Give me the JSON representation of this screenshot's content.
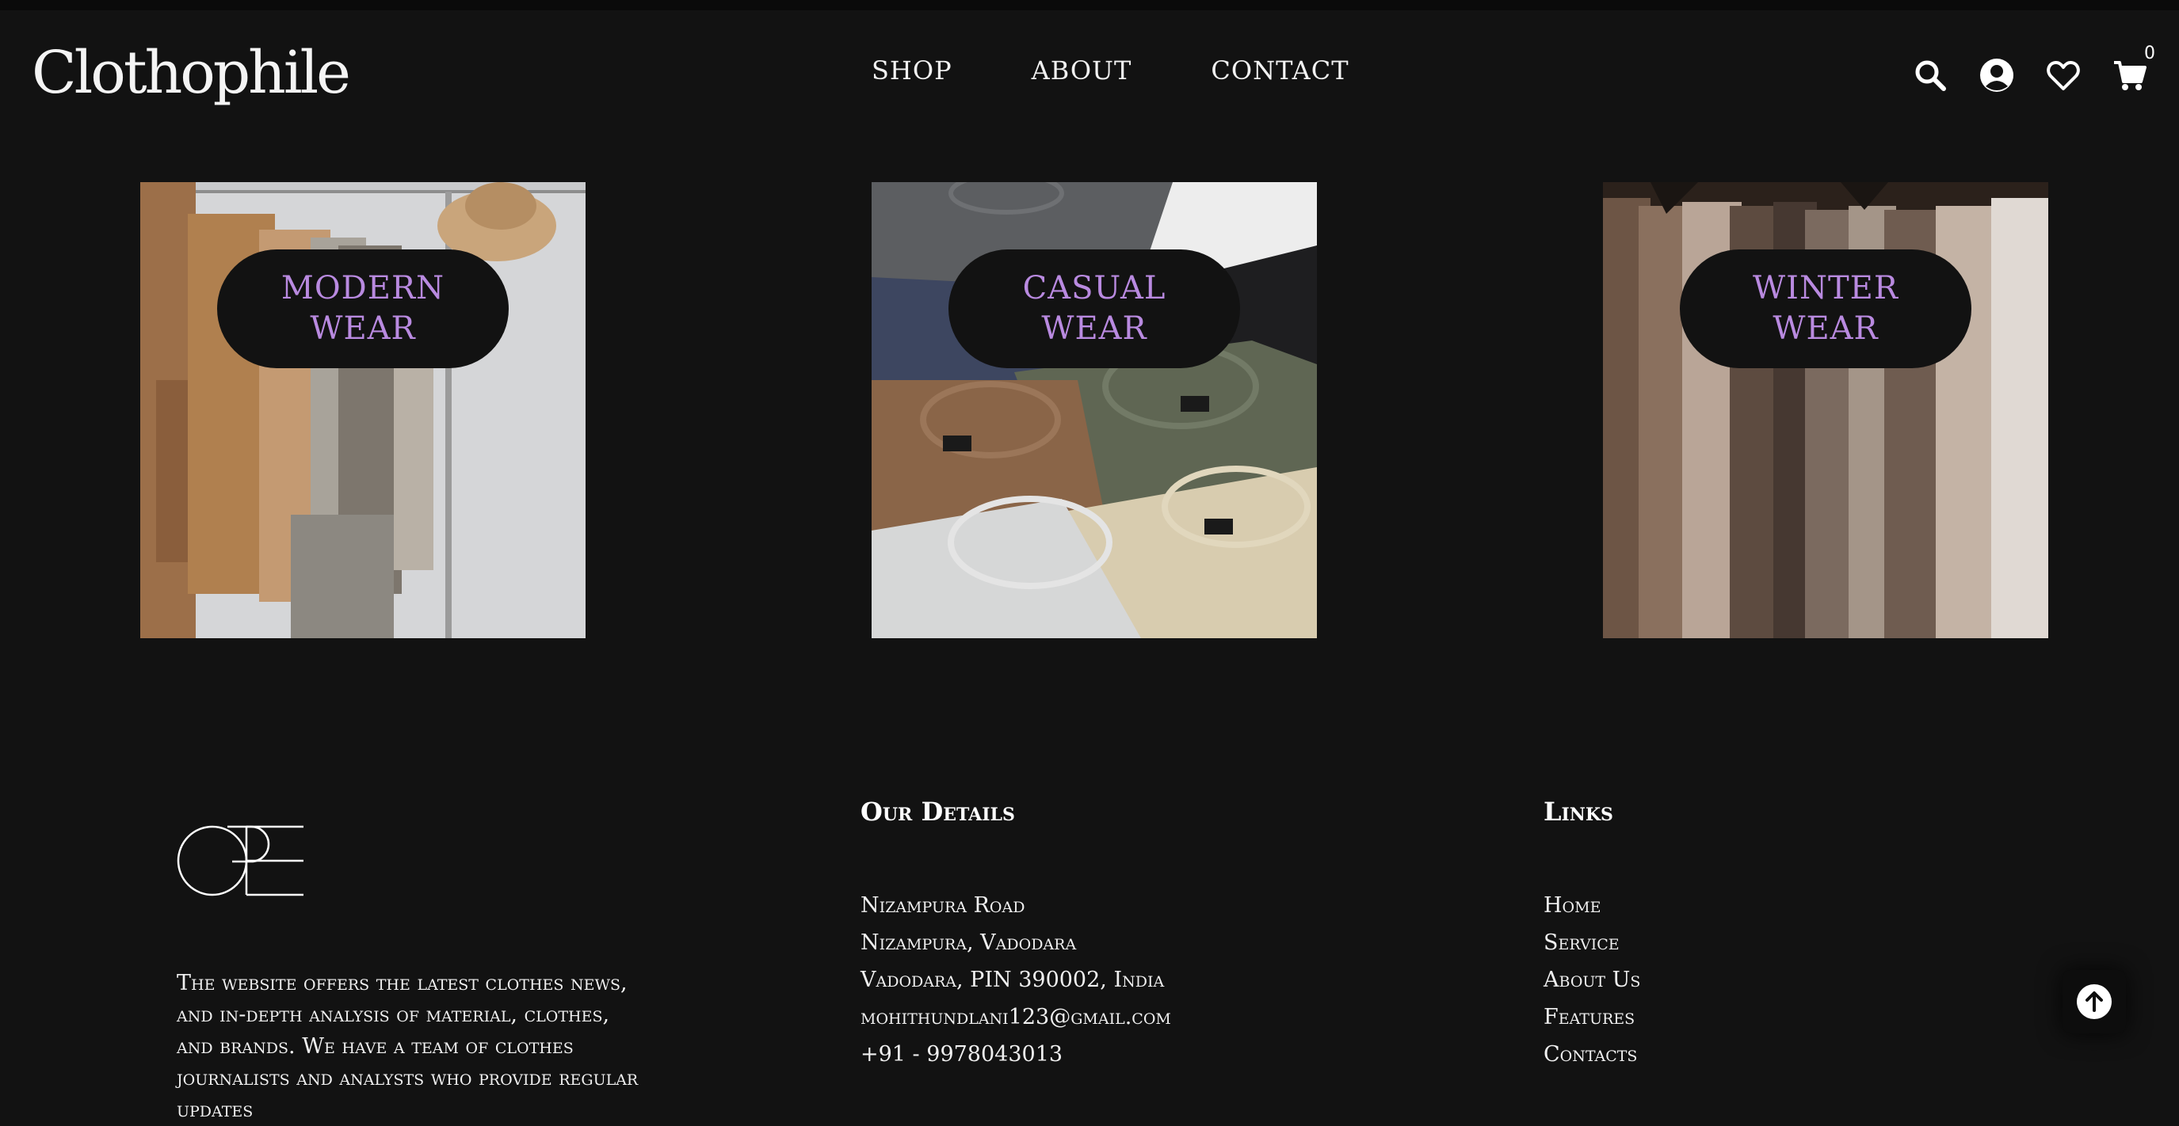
{
  "header": {
    "logo": "Clothophile",
    "nav": [
      "SHOP",
      "ABOUT",
      "CONTACT"
    ],
    "icons": [
      "search-icon",
      "user-icon",
      "heart-icon",
      "cart-icon"
    ],
    "cart_count": "0"
  },
  "categories": [
    {
      "label": "MODERN\nWEAR",
      "image": "modern-wear-photo"
    },
    {
      "label": "CASUAL\nWEAR",
      "image": "casual-wear-photo"
    },
    {
      "label": "WINTER\nWEAR",
      "image": "winter-wear-photo"
    }
  ],
  "footer": {
    "about_text": "The website offers the latest clothes news, and in-depth analysis of material, clothes, and brands. We have a team of clothes journalists and analysts who provide regular updates",
    "details": {
      "title": "Our Details",
      "lines": [
        "Nizampura Road",
        "Nizampura, Vadodara",
        "Vadodara, PIN 390002, India",
        "mohithundlani123@gmail.com",
        "+91 - 9978043013"
      ]
    },
    "links": {
      "title": "Links",
      "items": [
        "Home",
        "Service",
        "About Us",
        "Features",
        "Contacts"
      ]
    }
  },
  "colors": {
    "background": "#121212",
    "accent": "#b98ae0",
    "text": "#ffffff"
  },
  "scroll_top_icon": "arrow-up-icon"
}
